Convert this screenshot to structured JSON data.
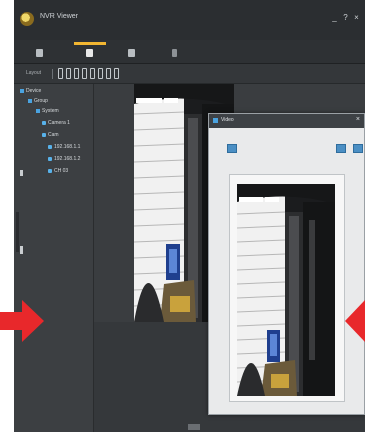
{
  "app": {
    "title": "NVR Viewer",
    "window_controls": [
      "_",
      "?",
      "×"
    ]
  },
  "tabs": [
    {
      "name": "tab-live",
      "active": false
    },
    {
      "name": "tab-playback",
      "active": true
    },
    {
      "name": "tab-config",
      "active": false
    },
    {
      "name": "tab-extra",
      "active": false
    }
  ],
  "toolbar": {
    "layout_label": "Layout",
    "tool_count": 8
  },
  "sidebar": {
    "tree": [
      {
        "label": "Device",
        "level": 0
      },
      {
        "label": "Group",
        "level": 1
      },
      {
        "label": "System",
        "level": 2
      },
      {
        "label": "Camera 1",
        "level": 3
      },
      {
        "label": "Cam",
        "level": 3
      },
      {
        "label": "192.168.1.1",
        "level": 4
      },
      {
        "label": "192.168.1.2",
        "level": 4
      },
      {
        "label": "CH 03",
        "level": 4
      }
    ]
  },
  "popup": {
    "title": "Video",
    "close": "×"
  },
  "colors": {
    "accent": "#f2b632",
    "arrow": "#e8282b",
    "tree_node": "#4aa3e0"
  }
}
